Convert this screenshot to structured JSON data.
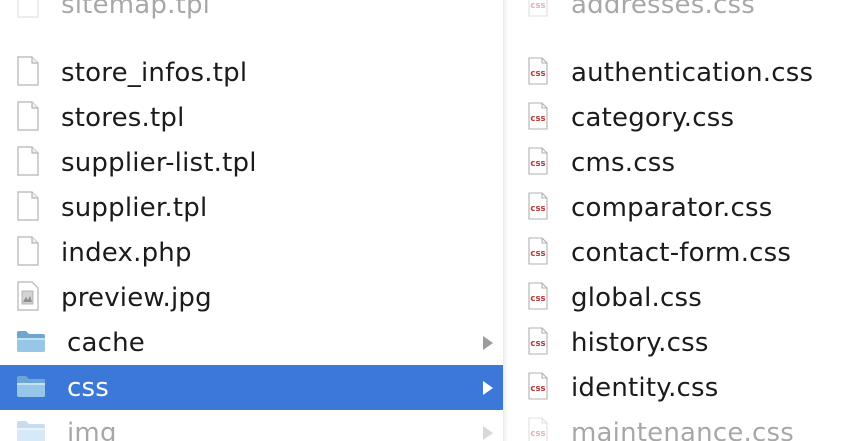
{
  "left_column": {
    "items": [
      {
        "label": "sitemap.tpl",
        "icon": "document-icon",
        "kind": "file",
        "state": "faded"
      },
      {
        "label": "store_infos.tpl",
        "icon": "document-icon",
        "kind": "file",
        "state": "normal"
      },
      {
        "label": "stores.tpl",
        "icon": "document-icon",
        "kind": "file",
        "state": "normal"
      },
      {
        "label": "supplier-list.tpl",
        "icon": "document-icon",
        "kind": "file",
        "state": "normal"
      },
      {
        "label": "supplier.tpl",
        "icon": "document-icon",
        "kind": "file",
        "state": "normal"
      },
      {
        "label": "index.php",
        "icon": "document-icon",
        "kind": "file",
        "state": "normal"
      },
      {
        "label": "preview.jpg",
        "icon": "image-file-icon",
        "kind": "file",
        "state": "normal"
      },
      {
        "label": "cache",
        "icon": "folder-icon",
        "kind": "folder",
        "state": "normal"
      },
      {
        "label": "css",
        "icon": "folder-icon",
        "kind": "folder",
        "state": "selected"
      },
      {
        "label": "img",
        "icon": "folder-icon",
        "kind": "folder",
        "state": "faded"
      }
    ]
  },
  "right_column": {
    "items": [
      {
        "label": "addresses.css",
        "icon": "css-file-icon",
        "state": "faded"
      },
      {
        "label": "authentication.css",
        "icon": "css-file-icon",
        "state": "normal"
      },
      {
        "label": "category.css",
        "icon": "css-file-icon",
        "state": "normal"
      },
      {
        "label": "cms.css",
        "icon": "css-file-icon",
        "state": "normal"
      },
      {
        "label": "comparator.css",
        "icon": "css-file-icon",
        "state": "normal"
      },
      {
        "label": "contact-form.css",
        "icon": "css-file-icon",
        "state": "normal"
      },
      {
        "label": "global.css",
        "icon": "css-file-icon",
        "state": "normal"
      },
      {
        "label": "history.css",
        "icon": "css-file-icon",
        "state": "normal"
      },
      {
        "label": "identity.css",
        "icon": "css-file-icon",
        "state": "normal"
      },
      {
        "label": "maintenance.css",
        "icon": "css-file-icon",
        "state": "faded"
      }
    ]
  },
  "colors": {
    "selection": "#3b78d8",
    "selected_text": "#ffffff",
    "text": "#1b1b1b",
    "css_icon_label": "#b23a3a"
  }
}
